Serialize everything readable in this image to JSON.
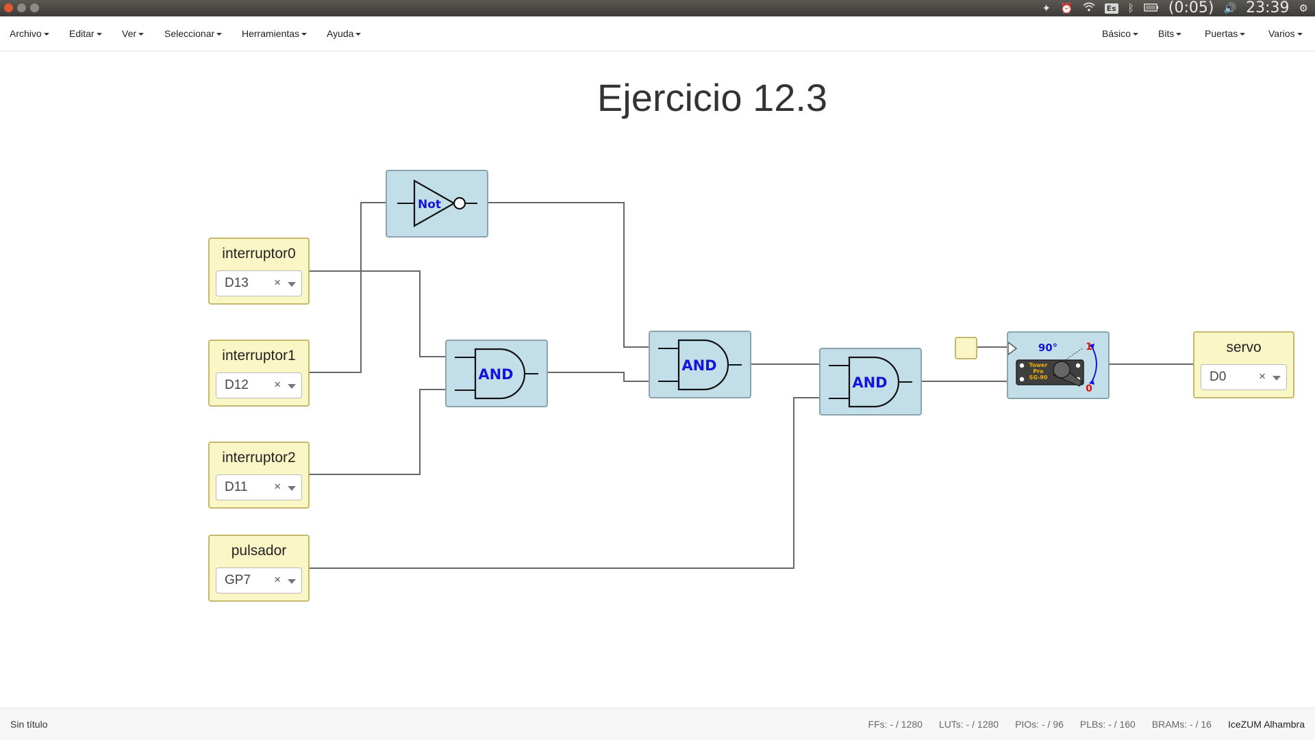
{
  "system_bar": {
    "input_lang": "Es",
    "battery_time": "(0:05)",
    "clock": "23:39"
  },
  "menu_left": [
    "Archivo",
    "Editar",
    "Ver",
    "Seleccionar",
    "Herramientas",
    "Ayuda"
  ],
  "menu_right": [
    "Básico",
    "Bits",
    "Puertas",
    "Varios"
  ],
  "canvas": {
    "title": "Ejercicio 12.3",
    "inputs": [
      {
        "label": "interruptor0",
        "pin": "D13"
      },
      {
        "label": "interruptor1",
        "pin": "D12"
      },
      {
        "label": "interruptor2",
        "pin": "D11"
      },
      {
        "label": "pulsador",
        "pin": "GP7"
      }
    ],
    "output": {
      "label": "servo",
      "pin": "D0"
    },
    "gates": {
      "not_label": "Not",
      "and_label": "AND"
    },
    "servo_block": {
      "angle": "90°",
      "top_value": "1",
      "bottom_value": "0",
      "brand_line1": "Tower",
      "brand_line2": "Pro",
      "brand_line3": "SG-90"
    }
  },
  "status_bar": {
    "file": "Sin título",
    "ffs": "FFs:  - / 1280",
    "luts": "LUTs:  - / 1280",
    "pios": "PIOs:  - / 96",
    "plbs": "PLBs:  - / 160",
    "brams": "BRAMs:  - / 16",
    "board": "IceZUM Alhambra"
  },
  "colors": {
    "input_block_bg": "#fbf6c5",
    "gate_block_bg": "#c2dfe9",
    "gate_label": "#1515d9",
    "wire": "#666666"
  }
}
